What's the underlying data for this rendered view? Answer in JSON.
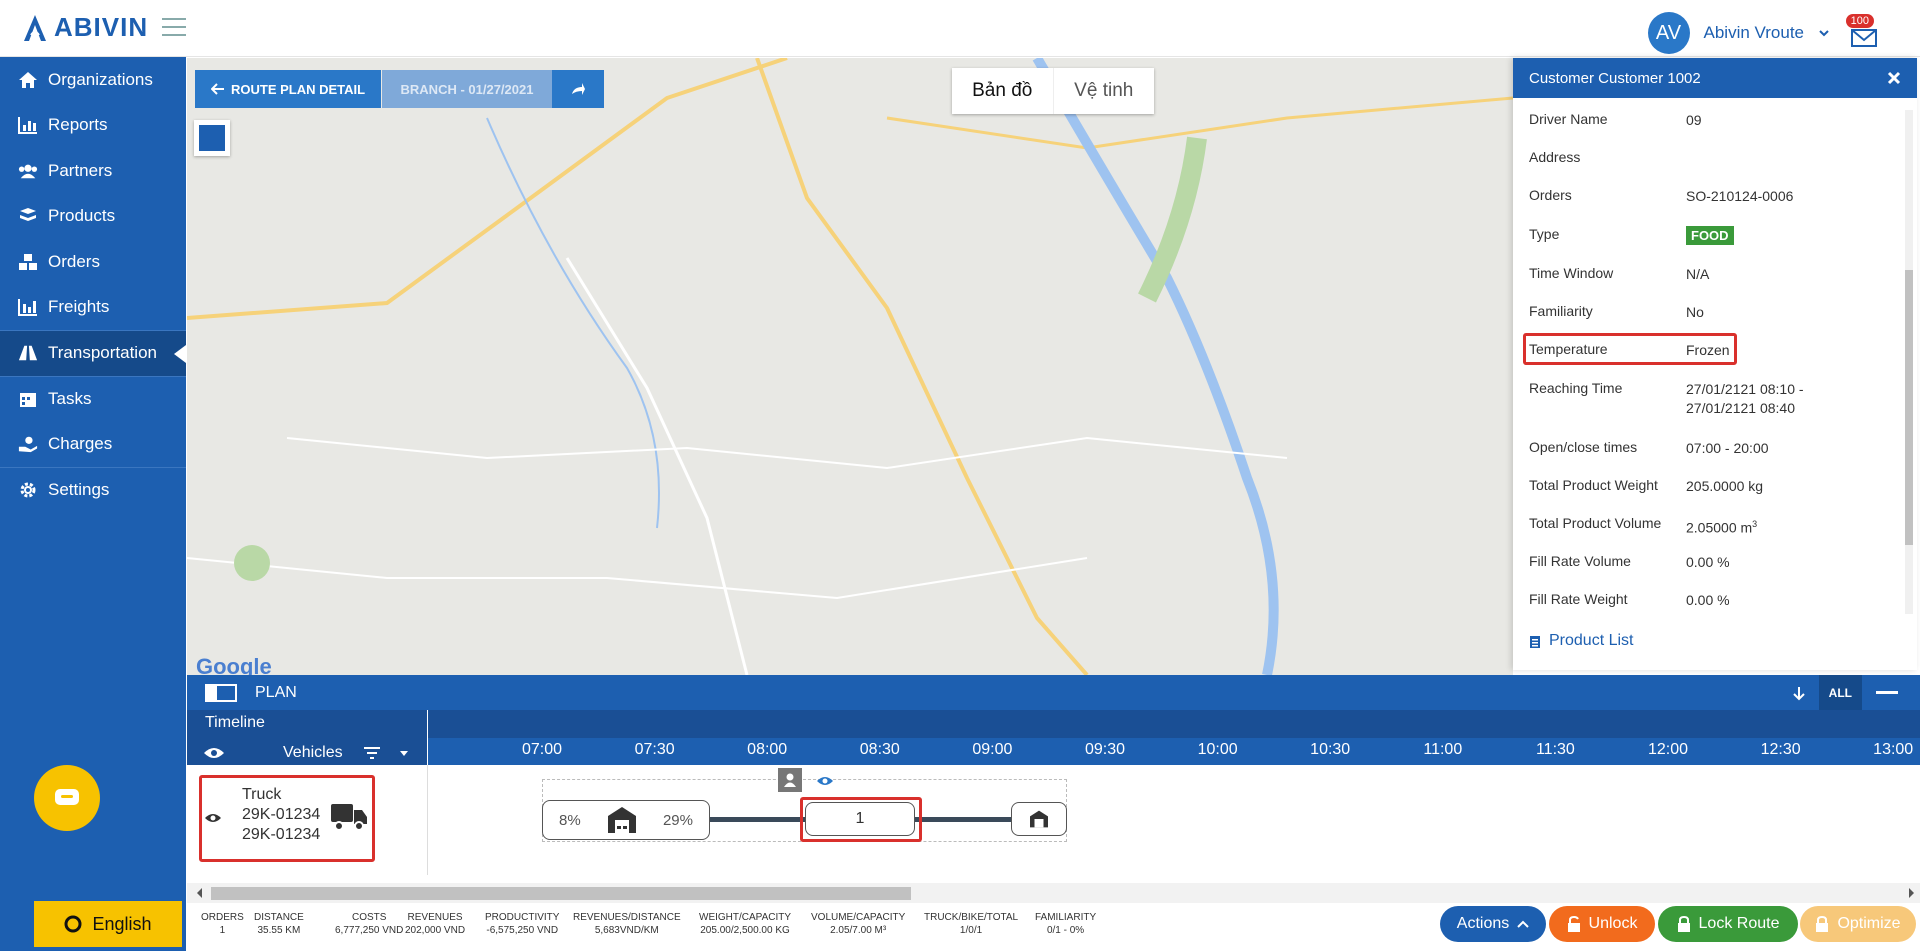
{
  "app": {
    "brand": "ABIVIN"
  },
  "user": {
    "initials": "AV",
    "name": "Abivin Vroute",
    "notifications": "100"
  },
  "sidebar": {
    "items": [
      {
        "label": "Organizations",
        "icon": "home-icon"
      },
      {
        "label": "Reports",
        "icon": "bar-chart-icon"
      },
      {
        "label": "Partners",
        "icon": "users-icon"
      },
      {
        "label": "Products",
        "icon": "boxes-icon"
      },
      {
        "label": "Orders",
        "icon": "cubes-icon"
      },
      {
        "label": "Freights",
        "icon": "freight-chart-icon"
      },
      {
        "label": "Transportation",
        "icon": "road-icon",
        "active": true
      },
      {
        "label": "Tasks",
        "icon": "calendar-icon"
      },
      {
        "label": "Charges",
        "icon": "hand-coin-icon"
      },
      {
        "label": "Settings",
        "icon": "gear-icon"
      }
    ],
    "language": "English"
  },
  "map_controls": {
    "route_plan_detail": "ROUTE PLAN DETAIL",
    "branch": "BRANCH - 01/27/2021",
    "map_tab": "Bản đồ",
    "satellite_tab": "Vệ tinh",
    "google": "Google"
  },
  "customer_panel": {
    "title": "Customer Customer 1002",
    "rows": {
      "driver_name": {
        "label": "Driver Name",
        "value": "09"
      },
      "address": {
        "label": "Address",
        "value": ""
      },
      "orders": {
        "label": "Orders",
        "value": "SO-210124-0006"
      },
      "type": {
        "label": "Type",
        "value": "FOOD"
      },
      "time_window": {
        "label": "Time Window",
        "value": "N/A"
      },
      "familiarity": {
        "label": "Familiarity",
        "value": "No"
      },
      "temperature": {
        "label": "Temperature",
        "value": "Frozen"
      },
      "reaching_time": {
        "label": "Reaching Time",
        "value": "27/01/2121 08:10 - 27/01/2121 08:40"
      },
      "open_close": {
        "label": "Open/close times",
        "value": "07:00 - 20:00"
      },
      "total_weight": {
        "label": "Total Product Weight",
        "value": "205.0000 kg"
      },
      "total_volume": {
        "label": "Total Product Volume",
        "value": "2.05000 m",
        "unit_sup": "3"
      },
      "fill_volume": {
        "label": "Fill Rate Volume",
        "value": "0.00 %"
      },
      "fill_weight": {
        "label": "Fill Rate Weight",
        "value": "0.00 %"
      }
    },
    "product_list": "Product List"
  },
  "plan": {
    "title": "PLAN",
    "all": "ALL",
    "timeline_title": "Timeline",
    "vehicles_label": "Vehicles",
    "times": [
      "07:00",
      "07:30",
      "08:00",
      "08:30",
      "09:00",
      "09:30",
      "10:00",
      "10:30",
      "11:00",
      "11:30",
      "12:00",
      "12:30",
      "13:00"
    ],
    "vehicle": {
      "type": "Truck",
      "plate1": "29K-01234",
      "plate2": "29K-01234"
    },
    "route": {
      "start_pct_left": "8%",
      "start_pct_right": "29%",
      "stop_number": "1"
    }
  },
  "stats": [
    {
      "label": "ORDERS",
      "value": "1"
    },
    {
      "label": "DISTANCE",
      "value": "35.55 KM"
    },
    {
      "label": "COSTS",
      "value": "6,777,250 VND"
    },
    {
      "label": "REVENUES",
      "value": "202,000 VND"
    },
    {
      "label": "PRODUCTIVITY",
      "value": "-6,575,250 VND"
    },
    {
      "label": "REVENUES/DISTANCE",
      "value": "5,683VND/KM"
    },
    {
      "label": "WEIGHT/CAPACITY",
      "value": "205.00/2,500.00 KG"
    },
    {
      "label": "VOLUME/CAPACITY",
      "value": "2.05/7.00 M³"
    },
    {
      "label": "TRUCK/BIKE/TOTAL",
      "value": "1/0/1"
    },
    {
      "label": "FAMILIARITY",
      "value": "0/1 - 0%"
    }
  ],
  "actions": {
    "actions": "Actions",
    "unlock": "Unlock",
    "lock_route": "Lock Route",
    "optimize": "Optimize"
  },
  "colors": {
    "primary": "#1d5fb0",
    "accent_yellow": "#f7c200",
    "highlight_red": "#d9302c",
    "food_green": "#3a9a3a",
    "unlock_orange": "#f26b1d",
    "lock_green": "#3a9a3a"
  }
}
